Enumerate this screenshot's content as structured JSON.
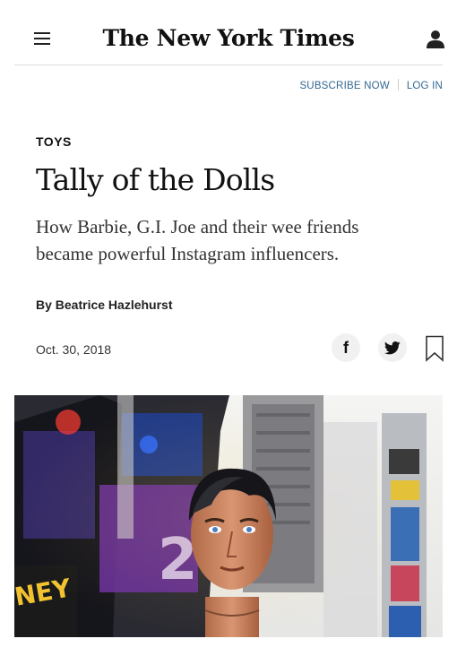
{
  "header": {
    "logo": "The New York Times",
    "menu_icon": "hamburger-menu-icon",
    "account_icon": "user-icon"
  },
  "toplinks": {
    "subscribe": "SUBSCRIBE NOW",
    "login": "LOG IN"
  },
  "article": {
    "section": "TOYS",
    "title": "Tally of the Dolls",
    "summary_line1": "How Barbie, G.I. Joe and their wee friends",
    "summary_line2": "became powerful Instagram influencers.",
    "byline": "By Beatrice Hazlehurst",
    "date": "Oct. 30, 2018"
  },
  "share": {
    "facebook_glyph": "f",
    "icons": [
      "facebook-icon",
      "twitter-icon",
      "bookmark-icon"
    ]
  },
  "colors": {
    "link_blue": "#326891",
    "text": "#121212",
    "divider": "#dcdcdc"
  }
}
